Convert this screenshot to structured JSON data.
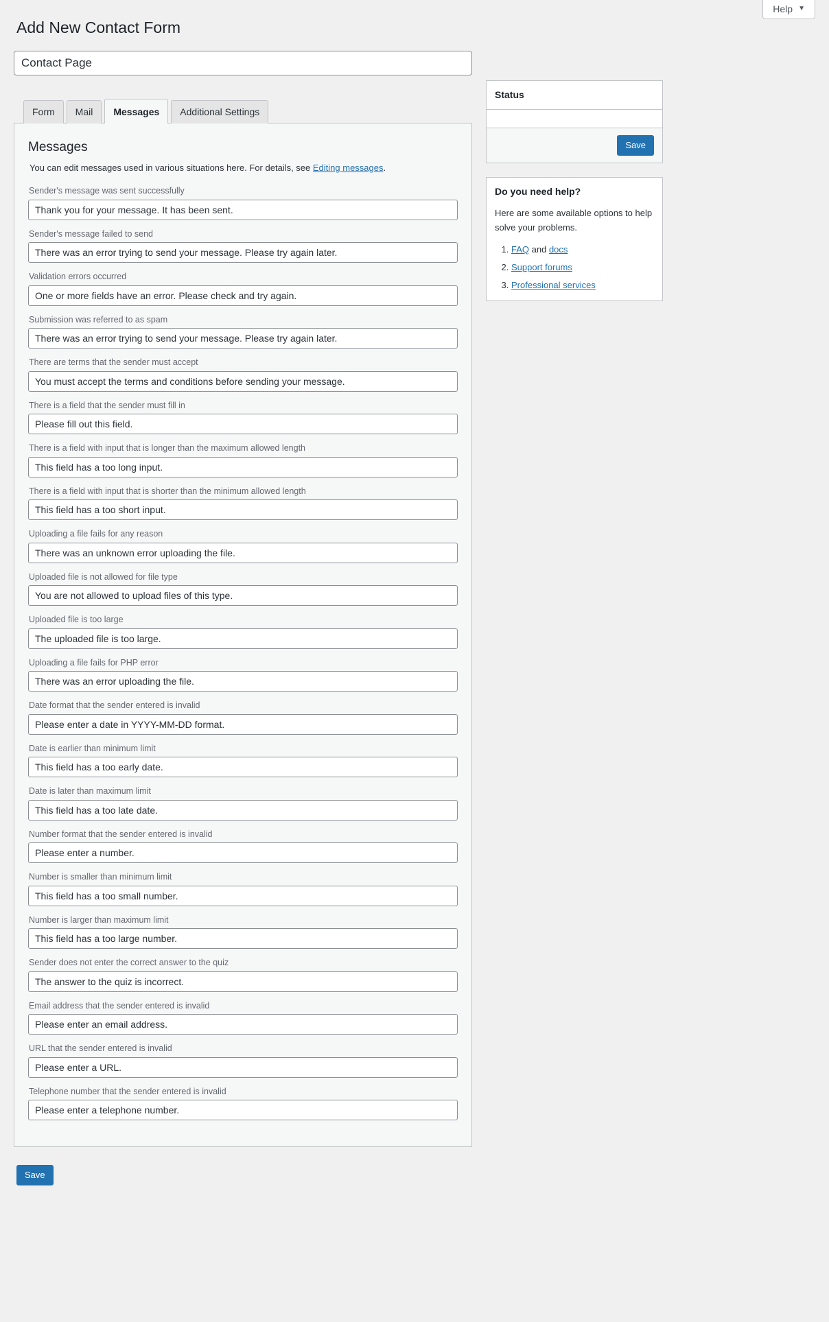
{
  "topbar": {
    "help_label": "Help",
    "help_caret": "chevron-down-icon"
  },
  "page": {
    "title": "Add New Contact Form",
    "title_input_value": "Contact Page",
    "title_input_placeholder": "Enter title here"
  },
  "tabs": [
    {
      "label": "Form",
      "active": false
    },
    {
      "label": "Mail",
      "active": false
    },
    {
      "label": "Messages",
      "active": true
    },
    {
      "label": "Additional Settings",
      "active": false
    }
  ],
  "messages_panel": {
    "heading": "Messages",
    "description_before": "You can edit messages used in various situations here. For details, see ",
    "description_link": "Editing messages",
    "description_after": ".",
    "fields": [
      {
        "label": "Sender's message was sent successfully",
        "value": "Thank you for your message. It has been sent."
      },
      {
        "label": "Sender's message failed to send",
        "value": "There was an error trying to send your message. Please try again later."
      },
      {
        "label": "Validation errors occurred",
        "value": "One or more fields have an error. Please check and try again."
      },
      {
        "label": "Submission was referred to as spam",
        "value": "There was an error trying to send your message. Please try again later."
      },
      {
        "label": "There are terms that the sender must accept",
        "value": "You must accept the terms and conditions before sending your message."
      },
      {
        "label": "There is a field that the sender must fill in",
        "value": "Please fill out this field."
      },
      {
        "label": "There is a field with input that is longer than the maximum allowed length",
        "value": "This field has a too long input."
      },
      {
        "label": "There is a field with input that is shorter than the minimum allowed length",
        "value": "This field has a too short input."
      },
      {
        "label": "Uploading a file fails for any reason",
        "value": "There was an unknown error uploading the file."
      },
      {
        "label": "Uploaded file is not allowed for file type",
        "value": "You are not allowed to upload files of this type."
      },
      {
        "label": "Uploaded file is too large",
        "value": "The uploaded file is too large."
      },
      {
        "label": "Uploading a file fails for PHP error",
        "value": "There was an error uploading the file."
      },
      {
        "label": "Date format that the sender entered is invalid",
        "value": "Please enter a date in YYYY-MM-DD format."
      },
      {
        "label": "Date is earlier than minimum limit",
        "value": "This field has a too early date."
      },
      {
        "label": "Date is later than maximum limit",
        "value": "This field has a too late date."
      },
      {
        "label": "Number format that the sender entered is invalid",
        "value": "Please enter a number."
      },
      {
        "label": "Number is smaller than minimum limit",
        "value": "This field has a too small number."
      },
      {
        "label": "Number is larger than maximum limit",
        "value": "This field has a too large number."
      },
      {
        "label": "Sender does not enter the correct answer to the quiz",
        "value": "The answer to the quiz is incorrect."
      },
      {
        "label": "Email address that the sender entered is invalid",
        "value": "Please enter an email address."
      },
      {
        "label": "URL that the sender entered is invalid",
        "value": "Please enter a URL."
      },
      {
        "label": "Telephone number that the sender entered is invalid",
        "value": "Please enter a telephone number."
      }
    ]
  },
  "sidebar": {
    "status_box": {
      "title": "Status",
      "save_label": "Save"
    },
    "help_box": {
      "title": "Do you need help?",
      "intro": "Here are some available options to help solve your problems.",
      "items": [
        {
          "prefix": "",
          "links": [
            "FAQ",
            "docs"
          ],
          "joiner": " and "
        },
        {
          "prefix": "",
          "links": [
            "Support forums"
          ],
          "joiner": ""
        },
        {
          "prefix": "",
          "links": [
            "Professional services"
          ],
          "joiner": ""
        }
      ]
    }
  },
  "footer": {
    "save_label": "Save"
  },
  "colors": {
    "accent": "#2271b1",
    "page_bg": "#f0f0f1",
    "panel_bg": "#f6f7f7",
    "border": "#c3c4c7",
    "input_border": "#8c8f94",
    "label_text": "#646970"
  }
}
